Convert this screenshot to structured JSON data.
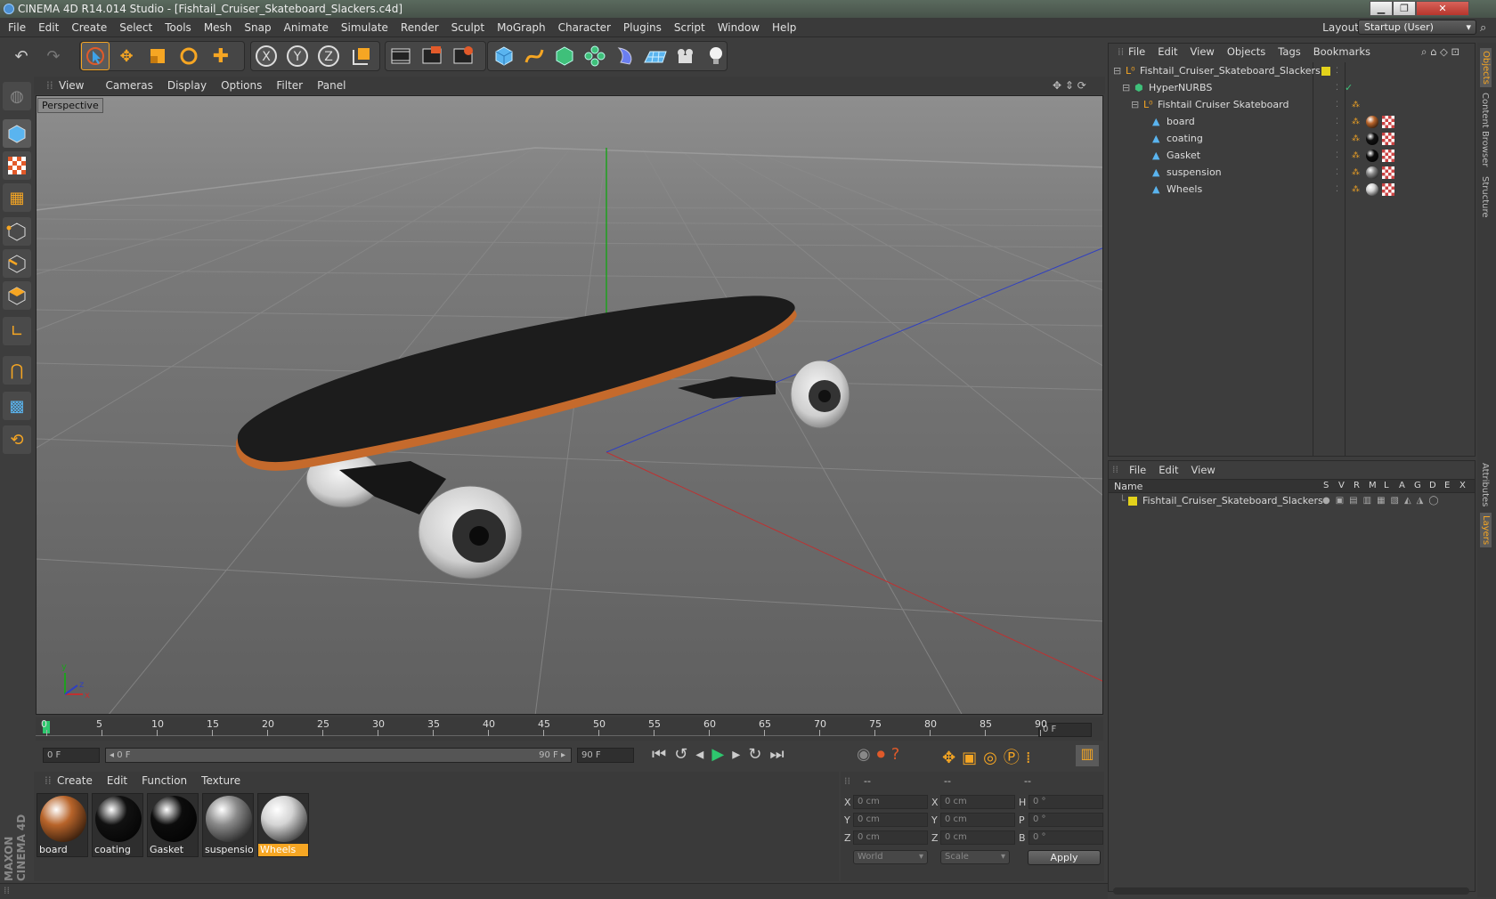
{
  "window": {
    "title": "CINEMA 4D R14.014 Studio - [Fishtail_Cruiser_Skateboard_Slackers.c4d]",
    "min_glyph": "▁",
    "max_glyph": "❐",
    "close_glyph": "✕"
  },
  "menu": [
    "File",
    "Edit",
    "Create",
    "Select",
    "Tools",
    "Mesh",
    "Snap",
    "Animate",
    "Simulate",
    "Render",
    "Sculpt",
    "MoGraph",
    "Character",
    "Plugins",
    "Script",
    "Window",
    "Help"
  ],
  "layout": {
    "label": "Layout:",
    "value": "Startup (User)"
  },
  "viewport": {
    "menu": [
      "View",
      "Cameras",
      "Display",
      "Options",
      "Filter",
      "Panel"
    ],
    "label": "Perspective"
  },
  "timeline": {
    "ticks": [
      "0",
      "5",
      "10",
      "15",
      "20",
      "25",
      "30",
      "35",
      "40",
      "45",
      "50",
      "55",
      "60",
      "65",
      "70",
      "75",
      "80",
      "85",
      "90"
    ],
    "current_frame": "0 F",
    "start_frame": "0 F",
    "range_start": "◂ 0 F",
    "range_end": "90 F ▸",
    "end_frame": "90 F"
  },
  "materials": {
    "menu": [
      "Create",
      "Edit",
      "Function",
      "Texture"
    ],
    "items": [
      {
        "name": "board",
        "color": "#b8642a"
      },
      {
        "name": "coating",
        "color": "#111111"
      },
      {
        "name": "Gasket",
        "color": "#0c0c0c"
      },
      {
        "name": "suspension",
        "color": "#8a8a8a"
      },
      {
        "name": "Wheels",
        "color": "#d4d4d4"
      }
    ],
    "selected": "Wheels"
  },
  "coords": {
    "headers": [
      "--",
      "--",
      "--"
    ],
    "rows": [
      {
        "a": "X",
        "av": "0 cm",
        "b": "X",
        "bv": "0 cm",
        "c": "H",
        "cv": "0 °"
      },
      {
        "a": "Y",
        "av": "0 cm",
        "b": "Y",
        "bv": "0 cm",
        "c": "P",
        "cv": "0 °"
      },
      {
        "a": "Z",
        "av": "0 cm",
        "b": "Z",
        "bv": "0 cm",
        "c": "B",
        "cv": "0 °"
      }
    ],
    "mode1": "World",
    "mode2": "Scale",
    "apply": "Apply"
  },
  "objects": {
    "menu": [
      "File",
      "Edit",
      "View",
      "Objects",
      "Tags",
      "Bookmarks"
    ],
    "tree": [
      {
        "name": "Fishtail_Cruiser_Skateboard_Slackers",
        "level": 0,
        "icon": "null",
        "mat": ""
      },
      {
        "name": "HyperNURBS",
        "level": 1,
        "icon": "nurbs",
        "mat": ""
      },
      {
        "name": "Fishtail Cruiser Skateboard",
        "level": 2,
        "icon": "null",
        "mat": ""
      },
      {
        "name": "board",
        "level": 3,
        "icon": "poly",
        "mat": "#b8642a"
      },
      {
        "name": "coating",
        "level": 3,
        "icon": "poly",
        "mat": "#111111"
      },
      {
        "name": "Gasket",
        "level": 3,
        "icon": "poly",
        "mat": "#0c0c0c"
      },
      {
        "name": "suspension",
        "level": 3,
        "icon": "poly",
        "mat": "#8a8a8a"
      },
      {
        "name": "Wheels",
        "level": 3,
        "icon": "poly",
        "mat": "#d4d4d4"
      }
    ]
  },
  "layers": {
    "menu": [
      "File",
      "Edit",
      "View"
    ],
    "header_name": "Name",
    "flags": [
      "S",
      "V",
      "R",
      "M",
      "L",
      "A",
      "G",
      "D",
      "E",
      "X"
    ],
    "items": [
      {
        "name": "Fishtail_Cruiser_Skateboard_Slackers",
        "color": "#e3d21b"
      }
    ]
  },
  "sidetabs": {
    "top": [
      "Objects",
      "Content Browser",
      "Structure"
    ],
    "bottom": [
      "Attributes",
      "Layers"
    ]
  },
  "brand": "MAXON CINEMA 4D",
  "colors": {
    "accent": "#f6a623",
    "selection": "#f6a623",
    "axis_y": "#1fa01f",
    "axis_x": "#c03030",
    "axis_z": "#3040c0"
  }
}
